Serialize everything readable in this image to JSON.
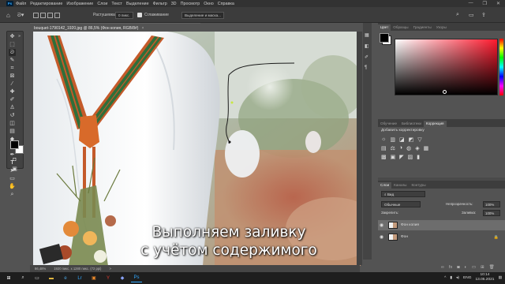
{
  "app": {
    "logo": "Ps",
    "menu": [
      "Файл",
      "Редактирование",
      "Изображение",
      "Слои",
      "Текст",
      "Выделение",
      "Фильтр",
      "3D",
      "Просмотр",
      "Окно",
      "Справка"
    ],
    "window_controls": [
      "—",
      "❐",
      "✕"
    ]
  },
  "options": {
    "feather_label": "Растушевка:",
    "feather_value": "0 пикс.",
    "antialias_label": "Сглаживание",
    "select_mask": "Выделение и маска..."
  },
  "document": {
    "tab_title": "bouquet-1790142_1920.jpg @ 86,5% (Фон копия, RGB/8#)",
    "close": "×",
    "status_zoom": "86,48%",
    "status_size": "1920 пикс. x 1280 пикс. (72 ppi)",
    "status_arrow": ">"
  },
  "caption": {
    "line1": "Выполняем заливку",
    "line2": "с учётом содержимого"
  },
  "panels": {
    "color_tabs": [
      "Цвет",
      "Образцы",
      "Градиенты",
      "Узоры"
    ],
    "adj_tabs": [
      "Обучение",
      "Библиотеки",
      "Коррекция"
    ],
    "adj_title": "Добавить корректировку",
    "adj_icons_row1": [
      "☼",
      "▥",
      "◪",
      "◩",
      "▽"
    ],
    "adj_icons_row2": [
      "▤",
      "⚖",
      "◑",
      "◍",
      "◈",
      "▦"
    ],
    "adj_icons_row3": [
      "▩",
      "▣",
      "◤",
      "▨",
      "▮"
    ],
    "layers_tabs": [
      "Слои",
      "Каналы",
      "Контуры"
    ],
    "layers_filter": "Вид",
    "blend_mode": "Обычные",
    "opacity_label": "Непрозрачность:",
    "opacity_value": "100%",
    "lock_label": "Закрепить:",
    "fill_label": "Заливка:",
    "fill_value": "100%",
    "layers": [
      {
        "name": "Фон копия"
      },
      {
        "name": "Фон"
      }
    ]
  },
  "taskbar": {
    "lang": "ENG",
    "time": "10:14",
    "date": "13.05.2021"
  },
  "colors": {
    "accent": "#31a8ff",
    "panel": "#535353",
    "ui_dark": "#323232"
  }
}
